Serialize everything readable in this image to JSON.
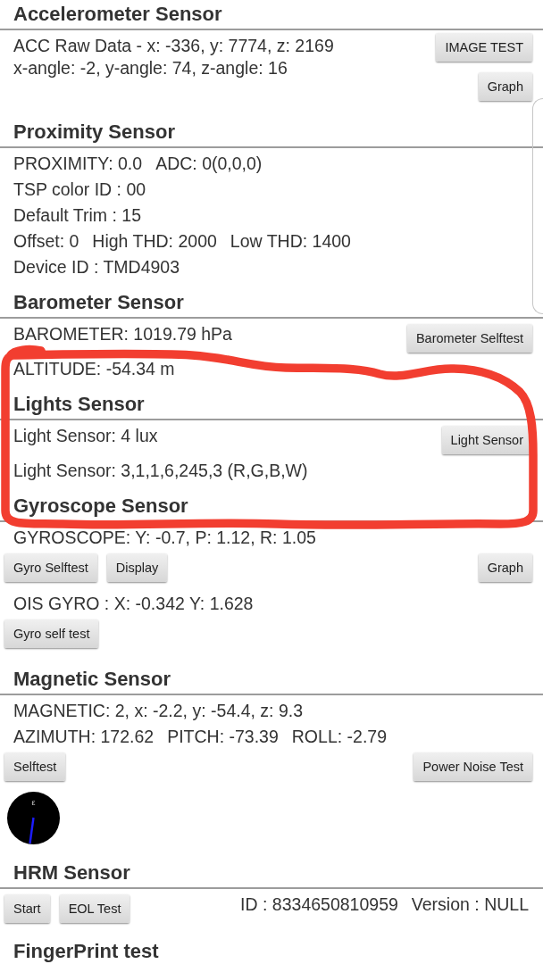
{
  "sections": [
    {
      "title": "Accelerometer Sensor",
      "rows": [
        {
          "kind": "column",
          "left": [
            {
              "kind": "text",
              "text": "ACC Raw Data - x: -336, y: 7774, z: 2169"
            },
            {
              "kind": "text",
              "text": "x-angle: -2, y-angle: 74, z-angle: 16"
            }
          ],
          "right": [
            {
              "kind": "button",
              "text": "IMAGE TEST"
            },
            {
              "kind": "button",
              "text": "Graph"
            }
          ]
        }
      ]
    },
    {
      "title": "Proximity Sensor",
      "rows": [
        {
          "kind": "line",
          "left": [
            {
              "kind": "text",
              "text": "PROXIMITY: 0.0"
            },
            {
              "kind": "text",
              "text": "ADC: 0(0,0,0)"
            }
          ]
        },
        {
          "kind": "line",
          "left": [
            {
              "kind": "text",
              "text": "TSP color ID : 00"
            }
          ]
        },
        {
          "kind": "line",
          "left": [
            {
              "kind": "text",
              "text": "Default Trim : 15"
            }
          ]
        },
        {
          "kind": "line",
          "left": [
            {
              "kind": "text",
              "text": "Offset: 0"
            },
            {
              "kind": "text",
              "text": "High THD: 2000"
            },
            {
              "kind": "text",
              "text": "Low THD: 1400"
            }
          ]
        },
        {
          "kind": "line",
          "left": [
            {
              "kind": "text",
              "text": "Device ID : TMD4903"
            }
          ]
        }
      ]
    },
    {
      "title": "Barometer Sensor",
      "rows": [
        {
          "kind": "line",
          "left": [
            {
              "kind": "text",
              "text": "BAROMETER: 1019.79 hPa"
            }
          ],
          "right": [
            {
              "kind": "button",
              "text": "Barometer Selftest"
            }
          ]
        },
        {
          "kind": "line",
          "left": [
            {
              "kind": "text",
              "text": "ALTITUDE: -54.34 m"
            }
          ]
        }
      ]
    },
    {
      "title": "Lights Sensor",
      "rows": [
        {
          "kind": "line",
          "left": [
            {
              "kind": "text",
              "text": "Light Sensor: 4 lux"
            }
          ],
          "right": [
            {
              "kind": "button",
              "text": "Light Sensor"
            }
          ]
        },
        {
          "kind": "line",
          "left": [
            {
              "kind": "text",
              "text": "Light Sensor: 3,1,1,6,245,3 (R,G,B,W)"
            }
          ]
        }
      ]
    },
    {
      "title": "Gyroscope Sensor",
      "rows": [
        {
          "kind": "line",
          "left": [
            {
              "kind": "text",
              "text": "GYROSCOPE: Y: -0.7, P: 1.12, R: 1.05"
            }
          ]
        },
        {
          "kind": "line",
          "left": [
            {
              "kind": "button",
              "text": "Gyro Selftest"
            },
            {
              "kind": "button",
              "text": "Display"
            }
          ],
          "right": [
            {
              "kind": "button",
              "text": "Graph"
            }
          ]
        },
        {
          "kind": "line",
          "left": [
            {
              "kind": "text",
              "text": "OIS GYRO : X: -0.342 Y: 1.628"
            }
          ]
        },
        {
          "kind": "line",
          "left": [
            {
              "kind": "button",
              "text": "Gyro self test"
            }
          ]
        }
      ]
    },
    {
      "title": "Magnetic Sensor",
      "rows": [
        {
          "kind": "line",
          "left": [
            {
              "kind": "text",
              "text": "MAGNETIC: 2, x: -2.2, y: -54.4, z: 9.3"
            }
          ]
        },
        {
          "kind": "line",
          "left": [
            {
              "kind": "text",
              "text": "AZIMUTH: 172.62"
            },
            {
              "kind": "text",
              "text": "PITCH: -73.39"
            },
            {
              "kind": "text",
              "text": "ROLL: -2.79"
            }
          ]
        },
        {
          "kind": "line",
          "left": [
            {
              "kind": "button",
              "text": "Selftest"
            }
          ],
          "right": [
            {
              "kind": "button",
              "text": "Power Noise Test"
            }
          ]
        },
        {
          "kind": "compass",
          "label": "ε"
        }
      ]
    },
    {
      "title": "HRM Sensor",
      "rows": [
        {
          "kind": "line",
          "left": [
            {
              "kind": "button",
              "text": "Start"
            },
            {
              "kind": "button",
              "text": "EOL Test"
            }
          ],
          "right": [
            {
              "kind": "text",
              "text": "ID : 8334650810959"
            },
            {
              "kind": "text",
              "text": "Version : NULL"
            }
          ]
        }
      ]
    },
    {
      "title": "FingerPrint test"
    }
  ],
  "annotation": {
    "kind": "loop"
  }
}
